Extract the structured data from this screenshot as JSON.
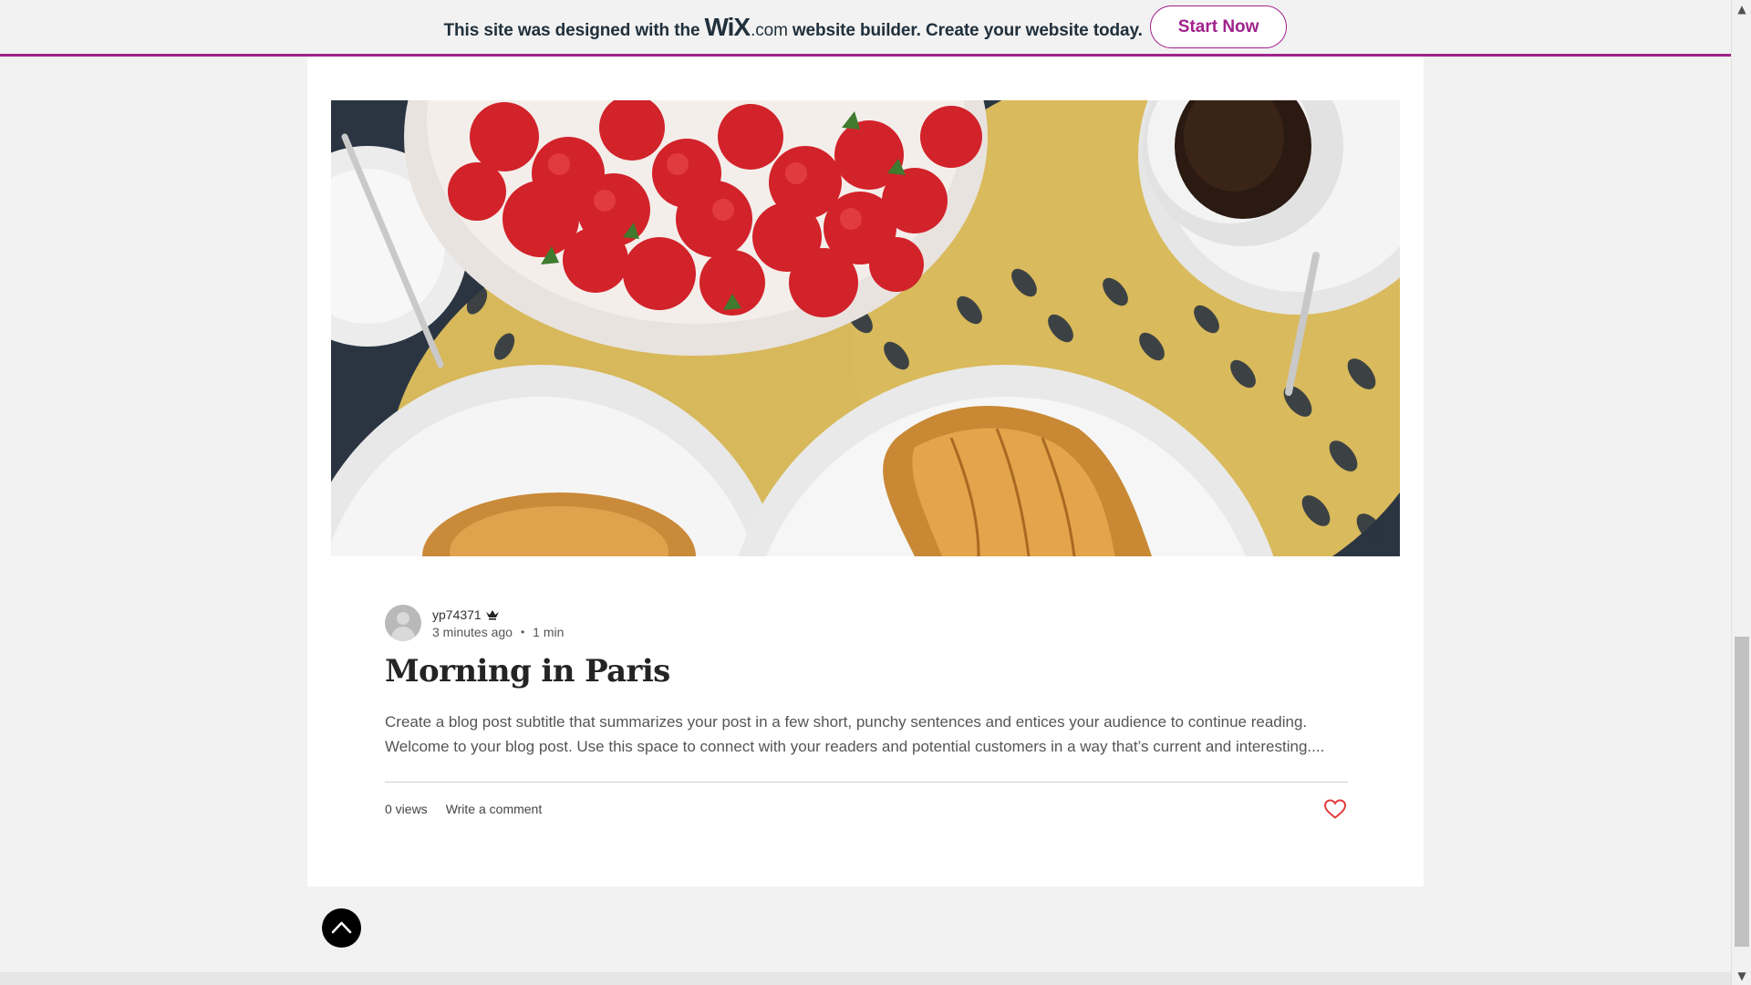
{
  "banner": {
    "text_before": "This site was designed with the",
    "logo": "WiX",
    "logo_suffix": ".com",
    "text_after": "website builder. Create your website today.",
    "cta": "Start Now",
    "accent_color": "#a0228c"
  },
  "post": {
    "author": "yp74371",
    "author_badge_icon": "crown-icon",
    "time_ago": "3 minutes ago",
    "read_time": "1 min",
    "title": "Morning in Paris",
    "excerpt": "Create a blog post subtitle that summarizes your post in a few short, punchy sentences and entices your audience to continue reading. Welcome to your blog post. Use this space to connect with your readers and potential customers in a way that’s current and interesting....",
    "views": "0 views",
    "comment_link": "Write a comment",
    "like_icon": "heart-icon",
    "like_color": "#e23b3b"
  },
  "controls": {
    "back_to_top_icon": "chevron-up-icon",
    "scroll_up_icon": "triangle-up-icon",
    "scroll_down_icon": "triangle-down-icon"
  }
}
